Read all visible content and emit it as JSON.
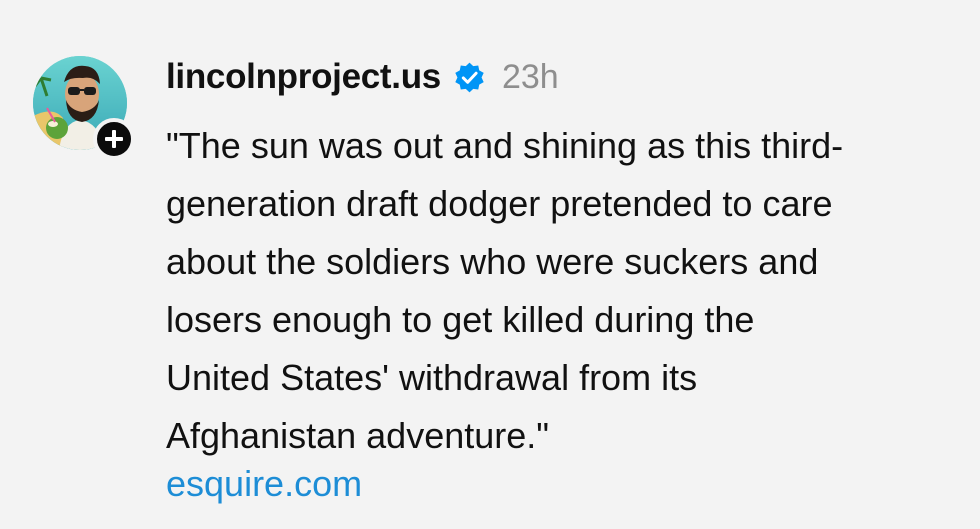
{
  "post": {
    "username": "lincolnproject.us",
    "time": "23h",
    "verified_icon": "verified-badge-icon",
    "follow_icon": "plus-icon",
    "text_lines": [
      "\"The sun was out and shining as this third-",
      "generation draft dodger pretended to care",
      "about the soldiers who were suckers and",
      "losers enough to get killed during the",
      "United States' withdrawal from its",
      "Afghanistan adventure.\""
    ],
    "link": "esquire.com"
  },
  "colors": {
    "background": "#f3f3f3",
    "text": "#111111",
    "muted": "#8e8e8e",
    "link": "#1d8dd6",
    "verified": "#0095f6"
  }
}
